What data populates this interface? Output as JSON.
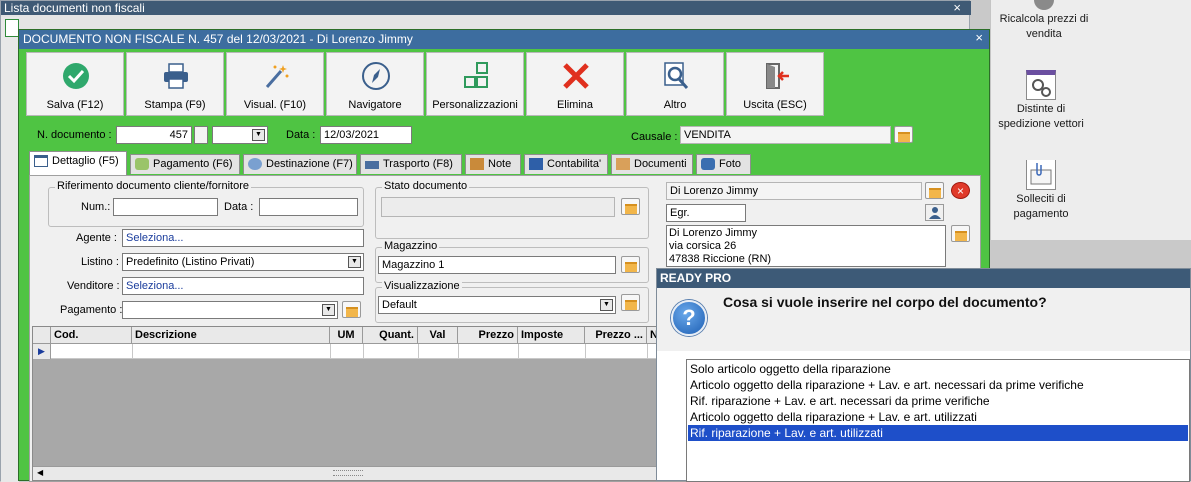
{
  "background_window": {
    "title": "Lista documenti non fiscali",
    "close": "×"
  },
  "right_panel": {
    "items": [
      {
        "label": "Ricalcola prezzi di vendita",
        "icon": "gear-icon"
      },
      {
        "label": "Distinte di spedizione vettori",
        "icon": "gears-icon"
      },
      {
        "label": "Solleciti di pagamento",
        "icon": "clip-letter-icon"
      }
    ]
  },
  "document_window": {
    "title": "DOCUMENTO NON FISCALE N. 457 del 12/03/2021 - Di Lorenzo Jimmy",
    "close": "×",
    "toolbar": [
      {
        "label": "Salva (F12)",
        "icon": "check-icon"
      },
      {
        "label": "Stampa (F9)",
        "icon": "printer-icon"
      },
      {
        "label": "Visual. (F10)",
        "icon": "magic-wand-icon"
      },
      {
        "label": "Navigatore",
        "icon": "compass-icon"
      },
      {
        "label": "Personalizzazioni",
        "icon": "grid-icon"
      },
      {
        "label": "Elimina",
        "icon": "delete-x-icon"
      },
      {
        "label": "Altro",
        "icon": "magnifier-icon"
      },
      {
        "label": "Uscita (ESC)",
        "icon": "exit-door-icon"
      }
    ],
    "header": {
      "n_documento_label": "N. documento :",
      "n_documento_value": "457",
      "data_label": "Data :",
      "data_value": "12/03/2021",
      "causale_label": "Causale :",
      "causale_value": "VENDITA"
    },
    "tabs": [
      {
        "label": "Dettaglio (F5)",
        "active": true
      },
      {
        "label": "Pagamento (F6)"
      },
      {
        "label": "Destinazione (F7)"
      },
      {
        "label": "Trasporto (F8)"
      },
      {
        "label": "Note"
      },
      {
        "label": "Contabilita'"
      },
      {
        "label": "Documenti"
      },
      {
        "label": "Foto"
      }
    ],
    "detail": {
      "rif_group_title": "Riferimento documento cliente/fornitore",
      "num_label": "Num.:",
      "num_value": "",
      "data_label": "Data :",
      "data_value": "",
      "agente_label": "Agente :",
      "agente_value": "Seleziona...",
      "listino_label": "Listino :",
      "listino_value": "Predefinito (Listino Privati)",
      "venditore_label": "Venditore :",
      "venditore_value": "Seleziona...",
      "pagamento_label": "Pagamento :",
      "pagamento_value": "",
      "stato_title": "Stato documento",
      "stato_value": "",
      "magazzino_title": "Magazzino",
      "magazzino_value": "Magazzino 1",
      "visualizzazione_title": "Visualizzazione",
      "visualizzazione_value": "Default",
      "cliente_nome": "Di Lorenzo Jimmy",
      "cliente_titolo": "Egr.",
      "indirizzo_lines": [
        "Di Lorenzo Jimmy",
        "via corsica 26",
        "47838 Riccione (RN)"
      ]
    },
    "grid_columns": [
      "Cod.",
      "Descrizione",
      "UM",
      "Quant.",
      "Val",
      "Prezzo",
      "Imposte",
      "Prezzo ...",
      "N"
    ]
  },
  "dialog": {
    "title": "READY PRO",
    "question": "Cosa si vuole inserire nel corpo del documento?",
    "options": [
      "Solo articolo oggetto della riparazione",
      "Articolo oggetto della riparazione + Lav. e art. necessari da prime verifiche",
      "Rif. riparazione + Lav. e art. necessari da prime verifiche",
      "Articolo oggetto della riparazione + Lav. e art. utilizzati",
      "Rif. riparazione + Lav. e art. utilizzati"
    ],
    "selected_index": 4
  },
  "colors": {
    "window_green": "#4fc443",
    "title_blue": "#3d6d9f",
    "selection": "#1e4fc9"
  }
}
